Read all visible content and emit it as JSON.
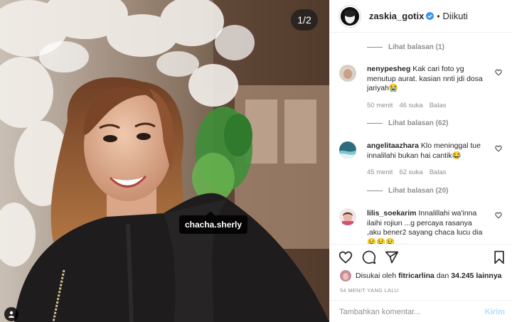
{
  "photo": {
    "counter": "1/2",
    "tag": "chacha.sherly"
  },
  "header": {
    "username": "zaskia_gotix",
    "separator": "•",
    "follow_status": "Diikuti"
  },
  "comments": [
    {
      "type": "replies",
      "label": "Lihat balasan (1)"
    },
    {
      "type": "comment",
      "username": "nenypesheg",
      "text": "Kak cari foto yg menutup aurat. kasian nnti jdi dosa jariyah😭",
      "time": "50 menit",
      "likes": "46 suka",
      "reply": "Balas"
    },
    {
      "type": "replies",
      "label": "Lihat balasan (62)"
    },
    {
      "type": "comment",
      "username": "angelitaazhara",
      "text": "Klo meninggal tue innalilahi bukan hai cantik😂",
      "time": "45 menit",
      "likes": "62 suka",
      "reply": "Balas"
    },
    {
      "type": "replies",
      "label": "Lihat balasan (20)"
    },
    {
      "type": "comment",
      "username": "lilis_soekarim",
      "text": "Innalillahi wa'inna ilaihi rojiun ...g percaya rasanya ,aku bener2 sayang chaca lucu dia 😢😢😢 ..."
    }
  ],
  "likes": {
    "prefix": "Disukai oleh",
    "user": "fitricarlina",
    "middle": "dan",
    "count": "34.245 lainnya"
  },
  "timestamp": "54 MENIT YANG LALU",
  "add_comment": {
    "placeholder": "Tambahkan komentar...",
    "post_label": "Kirim"
  },
  "colors": {
    "verified": "#3897f0",
    "muted": "#8e8e8e",
    "post_disabled": "#b3dbff"
  }
}
